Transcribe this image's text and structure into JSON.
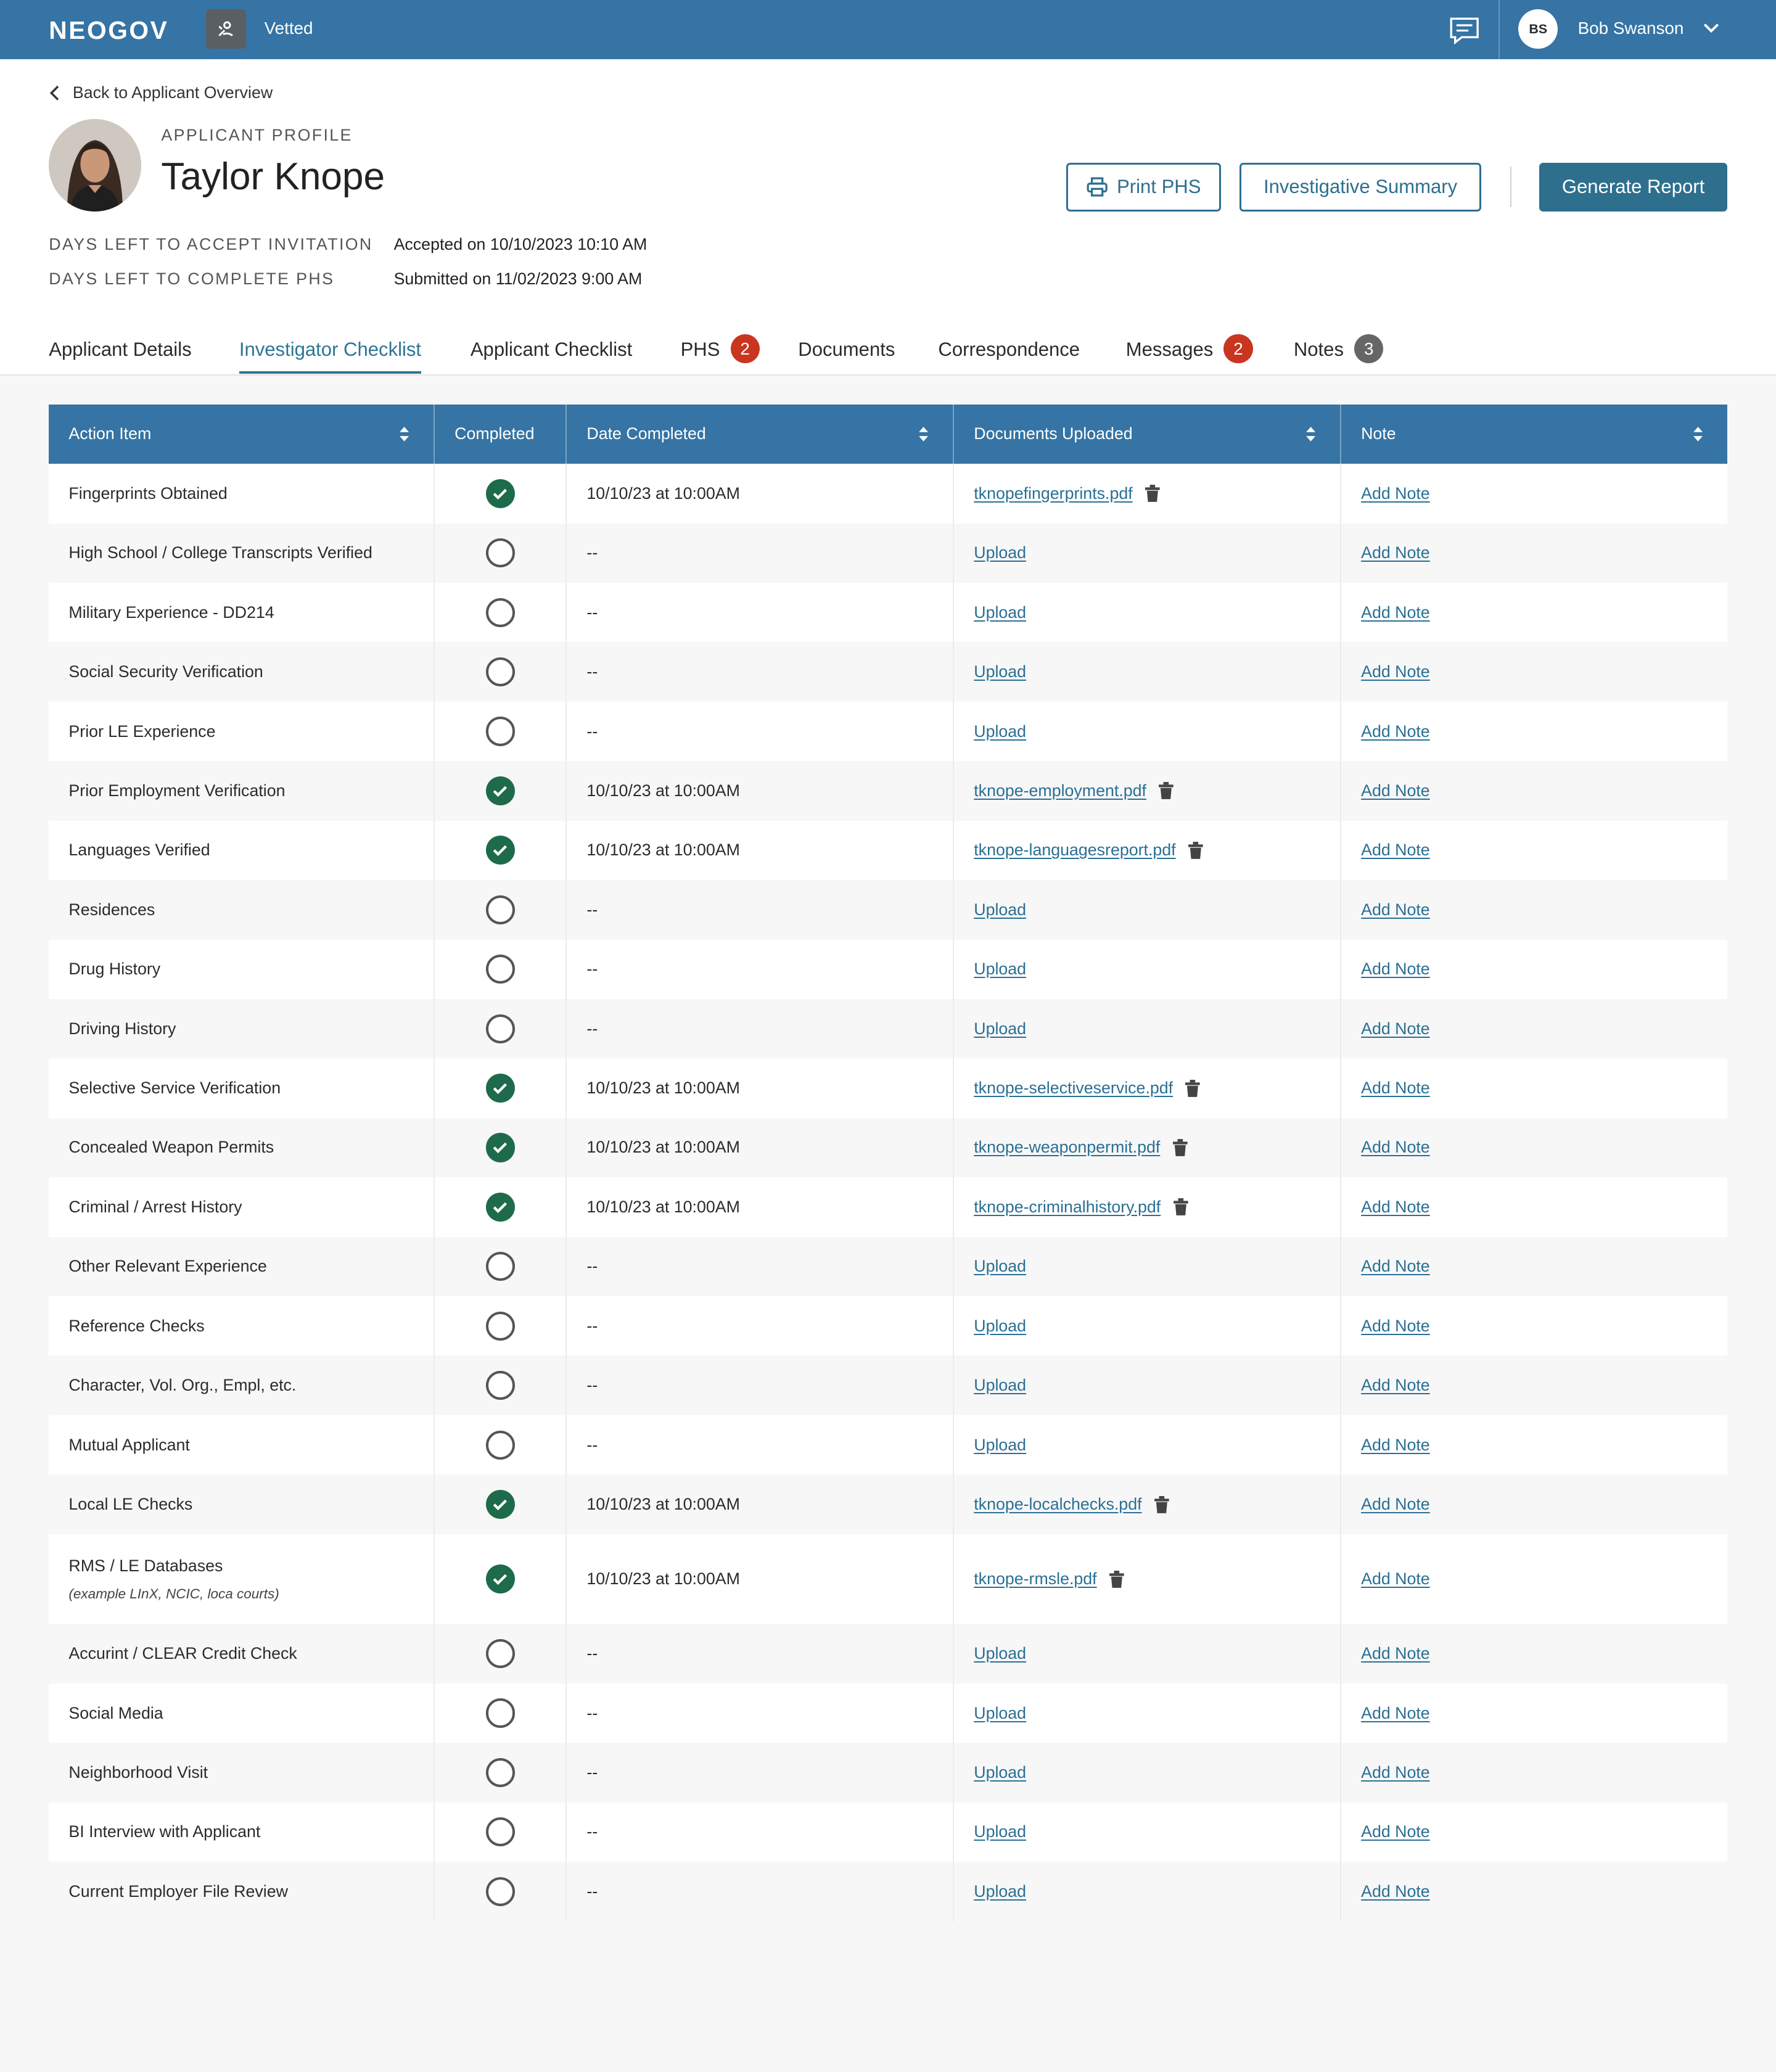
{
  "topbar": {
    "logo": "NEOGOV",
    "app_name": "Vetted",
    "user_initials": "BS",
    "user_name": "Bob Swanson"
  },
  "header": {
    "back_label": "Back to Applicant Overview",
    "profile_label": "APPLICANT PROFILE",
    "applicant_name": "Taylor Knope",
    "print_label": "Print PHS",
    "summary_label": "Investigative Summary",
    "generate_label": "Generate Report",
    "accept_label": "DAYS LEFT TO ACCEPT INVITATION",
    "accept_value": "Accepted on 10/10/2023 10:10 AM",
    "complete_label": "DAYS LEFT TO COMPLETE PHS",
    "complete_value": "Submitted on 11/02/2023 9:00 AM"
  },
  "tabs": [
    {
      "label": "Applicant Details",
      "badge": ""
    },
    {
      "label": "Investigator Checklist",
      "badge": "",
      "active": true
    },
    {
      "label": "Applicant Checklist",
      "badge": ""
    },
    {
      "label": "PHS",
      "badge": "2"
    },
    {
      "label": "Documents",
      "badge": ""
    },
    {
      "label": "Correspondence",
      "badge": ""
    },
    {
      "label": "Messages",
      "badge": "2"
    },
    {
      "label": "Notes",
      "badge": "3"
    }
  ],
  "table": {
    "headers": [
      "Action Item",
      "Completed",
      "Date Completed",
      "Documents Uploaded",
      "Note"
    ],
    "upload_label": "Upload",
    "note_label": "Add Note",
    "rows": [
      {
        "item": "Fingerprints Obtained",
        "sub": "",
        "done": true,
        "date": "10/10/23 at 10:00AM",
        "doc": "tknopefingerprints.pdf"
      },
      {
        "item": "High School / College Transcripts Verified",
        "sub": "",
        "done": false,
        "date": "--",
        "doc": ""
      },
      {
        "item": "Military Experience - DD214",
        "sub": "",
        "done": false,
        "date": "--",
        "doc": ""
      },
      {
        "item": "Social Security Verification",
        "sub": "",
        "done": false,
        "date": "--",
        "doc": ""
      },
      {
        "item": "Prior LE Experience",
        "sub": "",
        "done": false,
        "date": "--",
        "doc": ""
      },
      {
        "item": "Prior Employment Verification",
        "sub": "",
        "done": true,
        "date": "10/10/23 at 10:00AM",
        "doc": "tknope-employment.pdf"
      },
      {
        "item": "Languages Verified",
        "sub": "",
        "done": true,
        "date": "10/10/23 at 10:00AM",
        "doc": "tknope-languagesreport.pdf"
      },
      {
        "item": "Residences",
        "sub": "",
        "done": false,
        "date": "--",
        "doc": ""
      },
      {
        "item": "Drug History",
        "sub": "",
        "done": false,
        "date": "--",
        "doc": ""
      },
      {
        "item": "Driving History",
        "sub": "",
        "done": false,
        "date": "--",
        "doc": ""
      },
      {
        "item": "Selective Service Verification",
        "sub": "",
        "done": true,
        "date": "10/10/23 at 10:00AM",
        "doc": "tknope-selectiveservice.pdf"
      },
      {
        "item": "Concealed Weapon Permits",
        "sub": "",
        "done": true,
        "date": "10/10/23 at 10:00AM",
        "doc": "tknope-weaponpermit.pdf"
      },
      {
        "item": "Criminal / Arrest History",
        "sub": "",
        "done": true,
        "date": "10/10/23 at 10:00AM",
        "doc": "tknope-criminalhistory.pdf"
      },
      {
        "item": "Other Relevant Experience",
        "sub": "",
        "done": false,
        "date": "--",
        "doc": ""
      },
      {
        "item": "Reference Checks",
        "sub": "",
        "done": false,
        "date": "--",
        "doc": ""
      },
      {
        "item": "Character, Vol. Org., Empl, etc.",
        "sub": "",
        "done": false,
        "date": "--",
        "doc": ""
      },
      {
        "item": "Mutual Applicant",
        "sub": "",
        "done": false,
        "date": "--",
        "doc": ""
      },
      {
        "item": "Local LE Checks",
        "sub": "",
        "done": true,
        "date": "10/10/23 at 10:00AM",
        "doc": "tknope-localchecks.pdf"
      },
      {
        "item": "RMS / LE Databases",
        "sub": "(example LInX, NCIC, loca courts)",
        "done": true,
        "date": "10/10/23 at 10:00AM",
        "doc": "tknope-rmsle.pdf"
      },
      {
        "item": "Accurint / CLEAR Credit Check",
        "sub": "",
        "done": false,
        "date": "--",
        "doc": ""
      },
      {
        "item": "Social Media",
        "sub": "",
        "done": false,
        "date": "--",
        "doc": ""
      },
      {
        "item": "Neighborhood Visit",
        "sub": "",
        "done": false,
        "date": "--",
        "doc": ""
      },
      {
        "item": "BI Interview with Applicant",
        "sub": "",
        "done": false,
        "date": "--",
        "doc": ""
      },
      {
        "item": "Current Employer File Review",
        "sub": "",
        "done": false,
        "date": "--",
        "doc": ""
      }
    ]
  },
  "colors": {
    "brand": "#3574a4",
    "accent": "#2e6f8e",
    "success": "#1e6b4c",
    "badge": "#c9351f"
  }
}
